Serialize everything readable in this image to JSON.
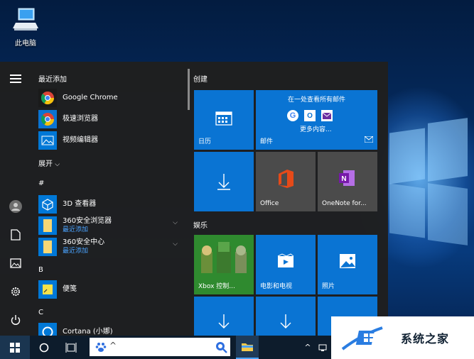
{
  "desktop": {
    "icon_label": "此电脑"
  },
  "start_menu": {
    "recent_header": "最近添加",
    "recent_apps": [
      {
        "label": "Google Chrome",
        "icon": "chrome-icon"
      },
      {
        "label": "极速浏览器",
        "icon": "chrome-icon"
      },
      {
        "label": "视频编辑器",
        "icon": "photo-icon"
      }
    ],
    "expand_label": "展开",
    "letter_hash": "#",
    "hash_apps": [
      {
        "label": "3D 查看器",
        "sub": "",
        "icon": "cube-icon"
      },
      {
        "label": "360安全浏览器",
        "sub": "最近添加",
        "icon": "folder-icon"
      },
      {
        "label": "360安全中心",
        "sub": "最近添加",
        "icon": "folder-icon"
      }
    ],
    "letter_b": "B",
    "b_apps": [
      {
        "label": "便笺",
        "icon": "sticky-note-icon"
      }
    ],
    "letter_c": "C",
    "c_apps": [
      {
        "label": "Cortana (小娜)",
        "icon": "cortana-icon"
      }
    ]
  },
  "tiles": {
    "group_create": "创建",
    "calendar_label": "日历",
    "mail_header": "在一处查看所有邮件",
    "mail_more": "更多内容...",
    "mail_label": "邮件",
    "office_label": "Office",
    "onenote_label": "OneNote for...",
    "group_play": "娱乐",
    "xbox_label": "Xbox 控制...",
    "movies_label": "电影和电视",
    "photos_label": "照片"
  },
  "taskbar": {
    "search_caret": "^"
  },
  "watermark": {
    "text": "系统之家"
  },
  "colors": {
    "accent": "#0a74d3",
    "menu_bg": "#1f1f1f",
    "taskbar": "#0d1c2c"
  }
}
